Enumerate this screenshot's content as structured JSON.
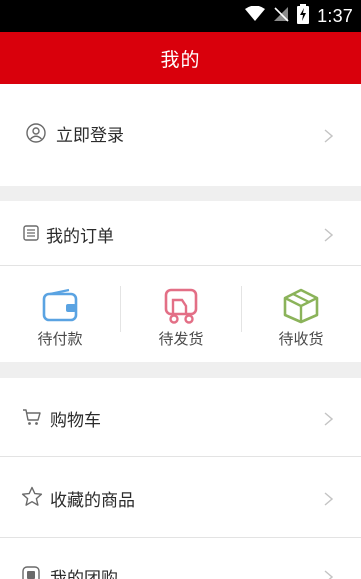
{
  "status_bar": {
    "time": "1:37"
  },
  "header": {
    "title": "我的"
  },
  "login": {
    "label": "立即登录",
    "icon": "user-circle-icon"
  },
  "my_orders": {
    "label": "我的订单",
    "icon": "order-list-icon"
  },
  "order_status": [
    {
      "label": "待付款",
      "icon": "wallet-icon",
      "color": "#5aa3e2"
    },
    {
      "label": "待发货",
      "icon": "truck-icon",
      "color": "#e36f86"
    },
    {
      "label": "待收货",
      "icon": "package-box-icon",
      "color": "#8bb35a"
    }
  ],
  "menu": [
    {
      "label": "购物车",
      "icon": "cart-icon"
    },
    {
      "label": "收藏的商品",
      "icon": "star-icon"
    },
    {
      "label": "我的团购",
      "icon": "group-buy-icon"
    }
  ],
  "colors": {
    "brand_red": "#d9000c",
    "page_bg": "#efefef",
    "text": "#2b2b2b"
  }
}
